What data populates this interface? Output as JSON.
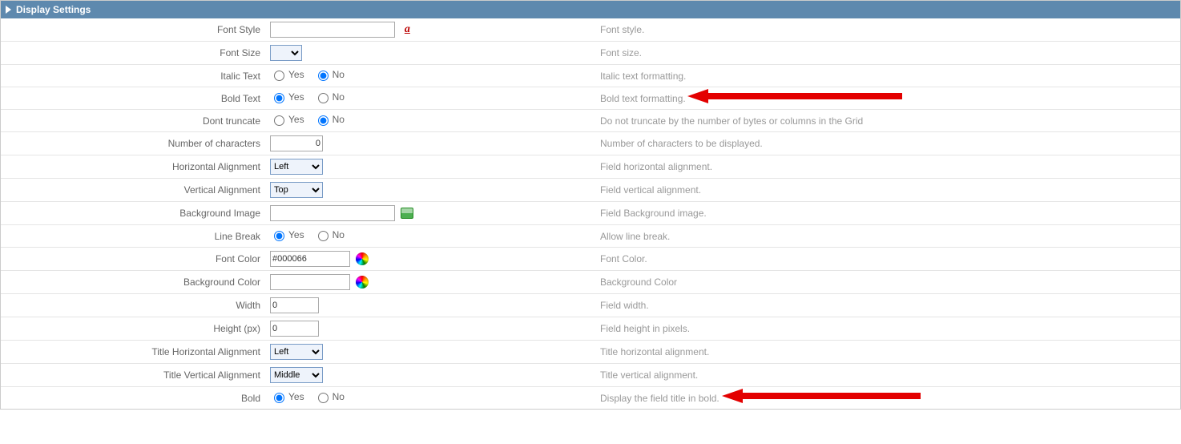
{
  "panel": {
    "title": "Display Settings"
  },
  "common": {
    "yes": "Yes",
    "no": "No"
  },
  "rows": {
    "fontStyle": {
      "label": "Font Style",
      "value": "",
      "desc": "Font style."
    },
    "fontSize": {
      "label": "Font Size",
      "value": "",
      "desc": "Font size."
    },
    "italic": {
      "label": "Italic Text",
      "desc": "Italic text formatting."
    },
    "bold": {
      "label": "Bold Text",
      "desc": "Bold text formatting."
    },
    "truncate": {
      "label": "Dont truncate",
      "desc": "Do not truncate by the number of bytes or columns in the Grid"
    },
    "numchars": {
      "label": "Number of characters",
      "value": "0",
      "desc": "Number of characters to be displayed."
    },
    "halign": {
      "label": "Horizontal Alignment",
      "value": "Left",
      "desc": "Field horizontal alignment."
    },
    "valign": {
      "label": "Vertical Alignment",
      "value": "Top",
      "desc": "Field vertical alignment."
    },
    "bgimg": {
      "label": "Background Image",
      "value": "",
      "desc": "Field Background image."
    },
    "linebreak": {
      "label": "Line Break",
      "desc": "Allow line break."
    },
    "fontcolor": {
      "label": "Font Color",
      "value": "#000066",
      "desc": "Font Color."
    },
    "bgcolor": {
      "label": "Background Color",
      "value": "",
      "desc": "Background Color"
    },
    "width": {
      "label": "Width",
      "value": "0",
      "desc": "Field width."
    },
    "height": {
      "label": "Height (px)",
      "value": "0",
      "desc": "Field height in pixels."
    },
    "thalign": {
      "label": "Title Horizontal Alignment",
      "value": "Left",
      "desc": "Title horizontal alignment."
    },
    "tvalign": {
      "label": "Title Vertical Alignment",
      "value": "Middle",
      "desc": "Title vertical alignment."
    },
    "tbold": {
      "label": "Bold",
      "desc": "Display the field title in bold."
    }
  }
}
